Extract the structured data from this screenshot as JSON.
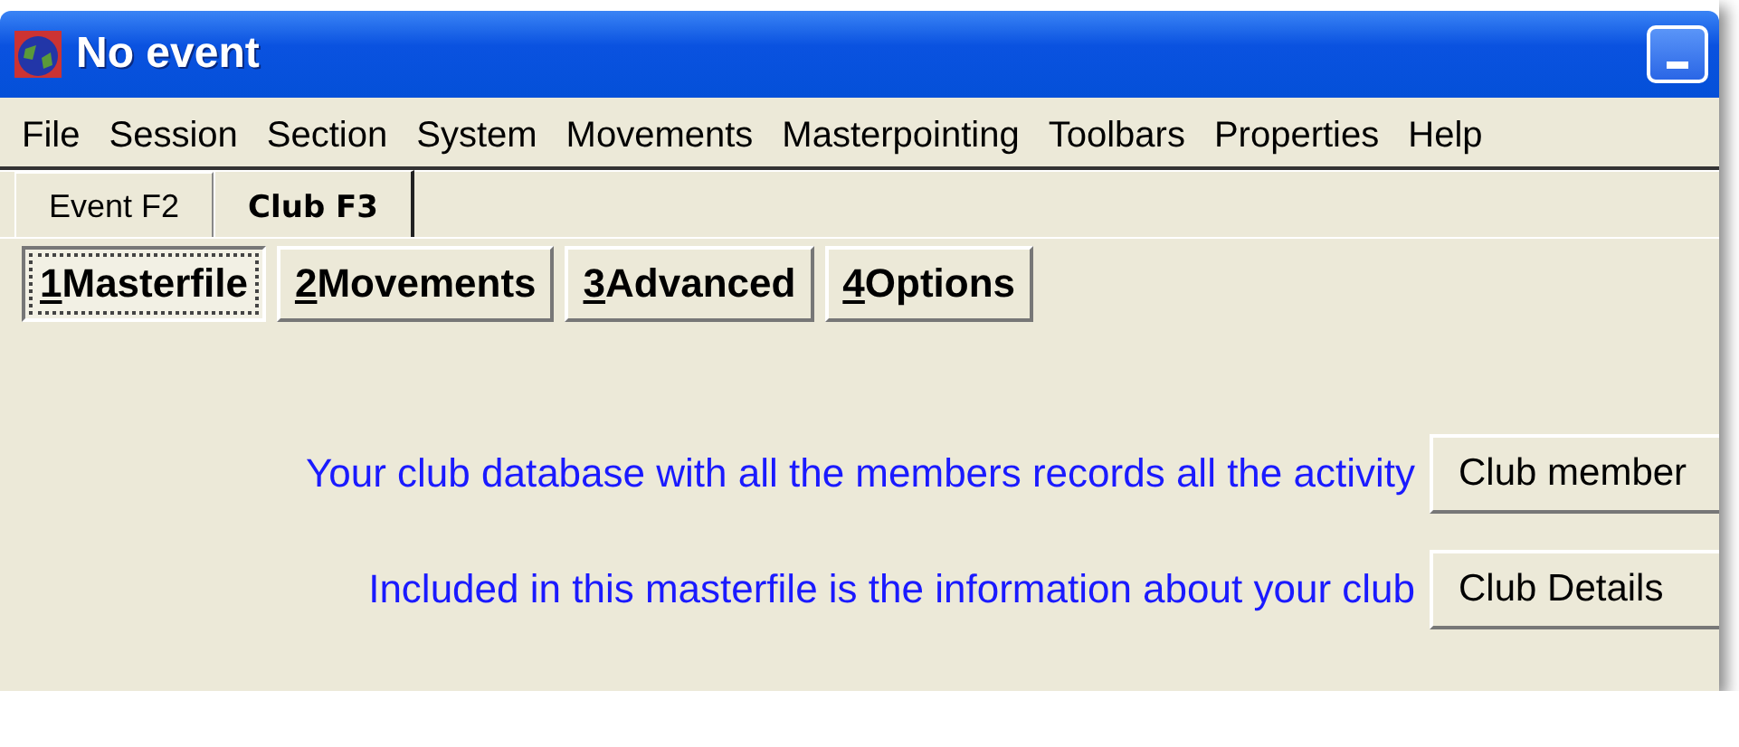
{
  "window": {
    "title": "No event"
  },
  "menu": [
    "File",
    "Session",
    "Section",
    "System",
    "Movements",
    "Masterpointing",
    "Toolbars",
    "Properties",
    "Help"
  ],
  "tabs": [
    {
      "label": "Event F2",
      "selected": false
    },
    {
      "label": "Club F3",
      "selected": true
    }
  ],
  "subtabs": [
    {
      "label": "1Masterfile",
      "selected": true
    },
    {
      "label": "2Movements",
      "selected": false
    },
    {
      "label": "3Advanced",
      "selected": false
    },
    {
      "label": "4Options",
      "selected": false
    }
  ],
  "rows": [
    {
      "text": "Your club database with all the members records all the activity",
      "button": "Club member"
    },
    {
      "text": "Included in this masterfile is the information about your club",
      "button": "Club Details"
    }
  ]
}
